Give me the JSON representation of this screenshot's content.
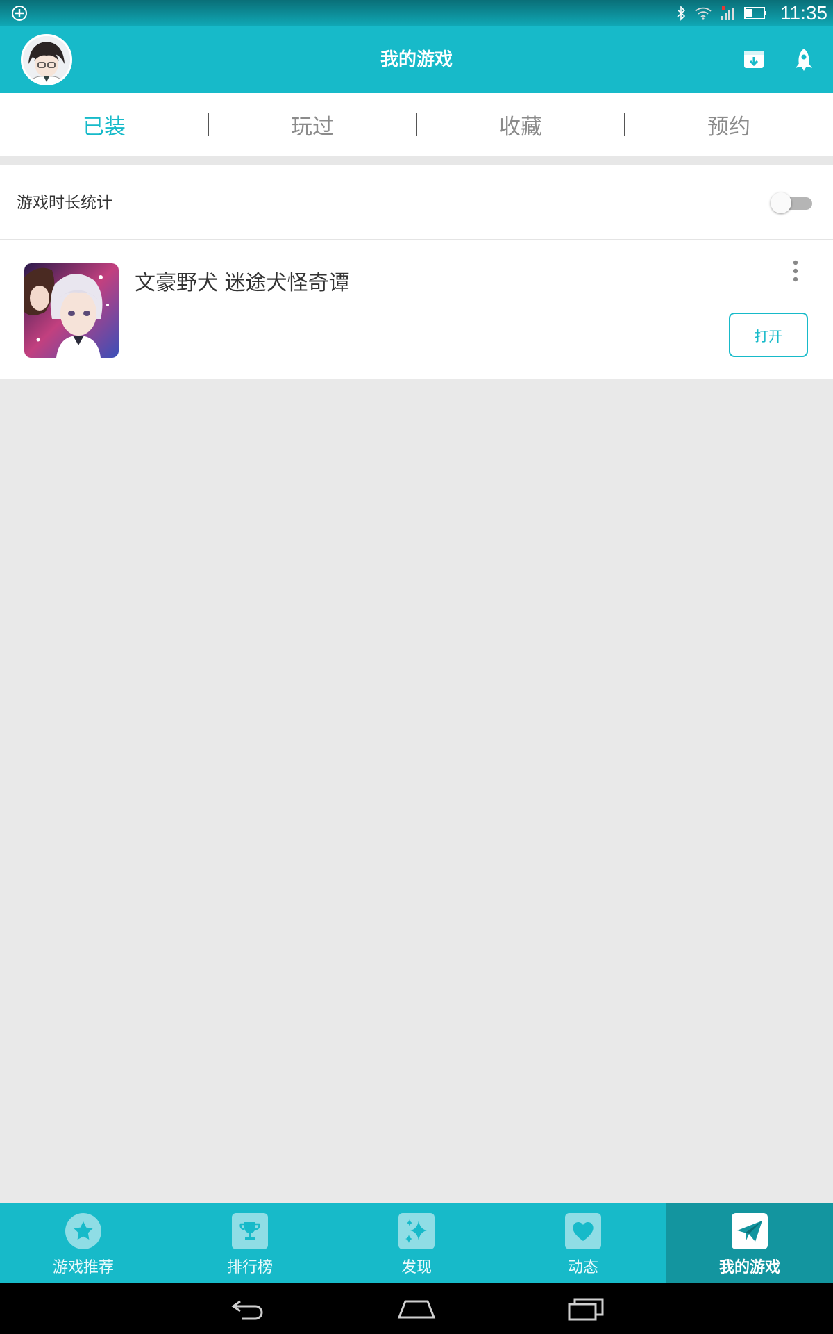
{
  "status_bar": {
    "time": "11:35",
    "icons": [
      "add-circle-icon",
      "bluetooth-icon",
      "wifi-icon",
      "signal-icon",
      "battery-icon"
    ]
  },
  "header": {
    "title": "我的游戏",
    "avatar": "avatar",
    "actions": [
      "download-box-icon",
      "rocket-icon"
    ],
    "accent_color": "#17bac9"
  },
  "tabs": [
    {
      "label": "已装",
      "active": true
    },
    {
      "label": "玩过",
      "active": false
    },
    {
      "label": "收藏",
      "active": false
    },
    {
      "label": "预约",
      "active": false
    }
  ],
  "stats": {
    "label": "游戏时长统计",
    "toggle_on": false
  },
  "games": [
    {
      "name": "文豪野犬 迷途犬怪奇谭",
      "button_label": "打开",
      "more_icon": "more-vert-icon"
    }
  ],
  "bottom_nav": [
    {
      "label": "游戏推荐",
      "icon": "star-icon",
      "active": false
    },
    {
      "label": "排行榜",
      "icon": "trophy-icon",
      "active": false
    },
    {
      "label": "发现",
      "icon": "sparkle-icon",
      "active": false
    },
    {
      "label": "动态",
      "icon": "heart-icon",
      "active": false
    },
    {
      "label": "我的游戏",
      "icon": "paper-plane-icon",
      "active": true
    }
  ],
  "system_nav": [
    "back-icon",
    "home-icon",
    "recents-icon"
  ]
}
